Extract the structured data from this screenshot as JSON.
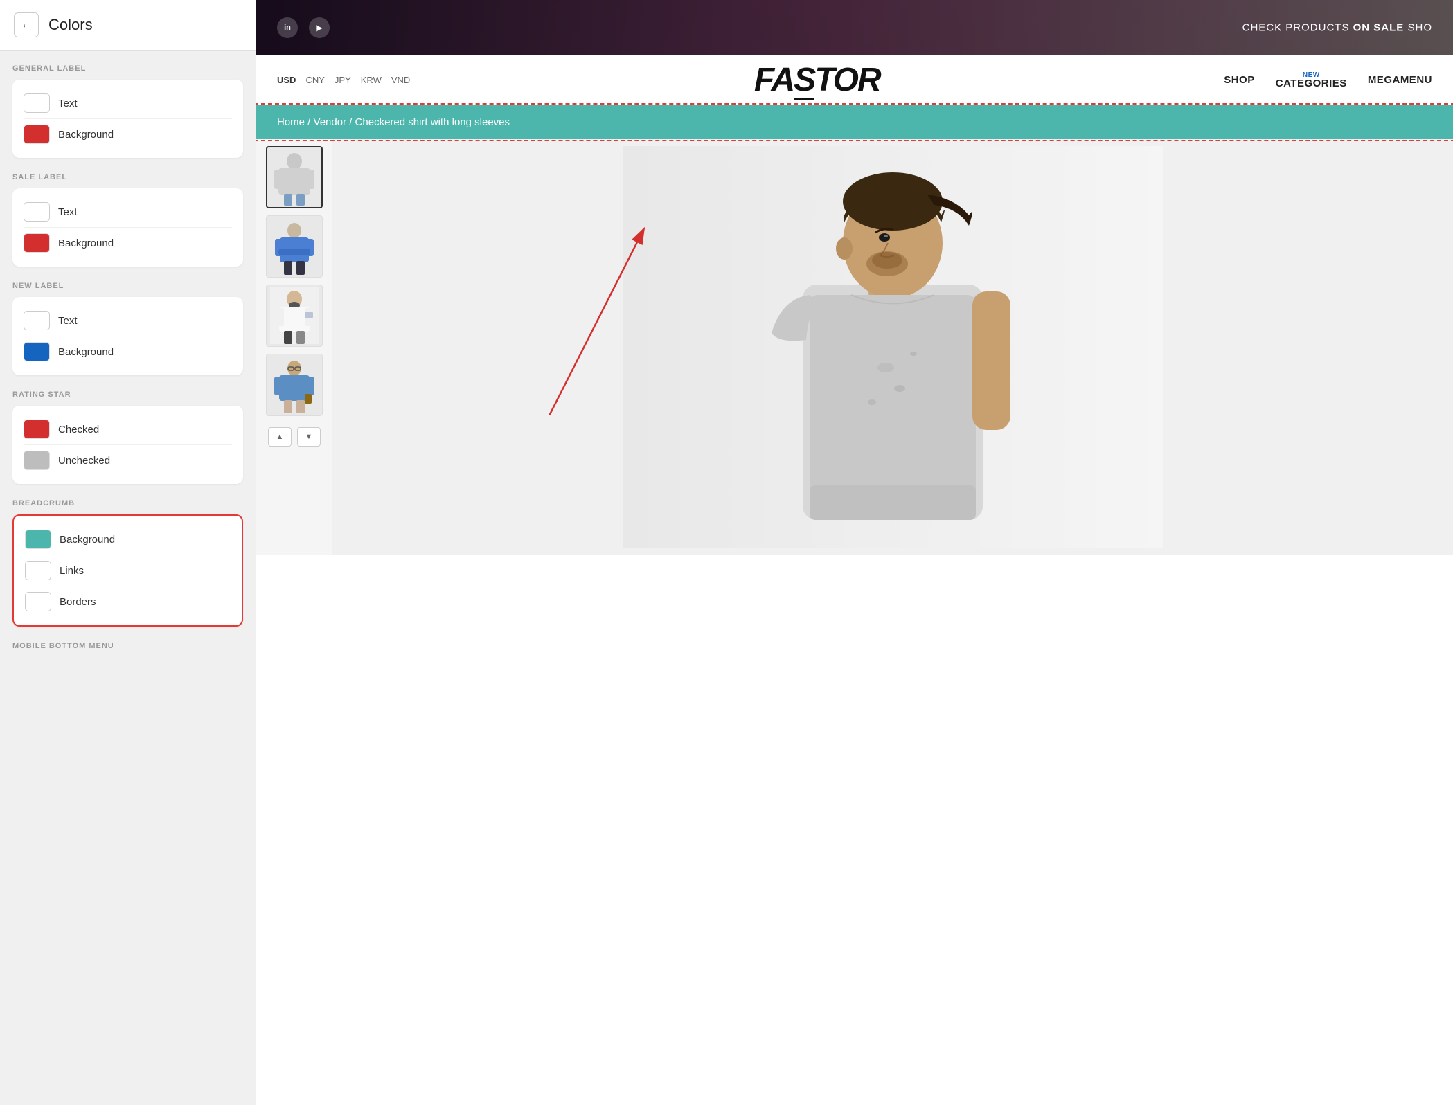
{
  "panel": {
    "title": "Colors",
    "back_label": "←",
    "sections": {
      "general_label": {
        "title": "GENERAL LABEL",
        "text_label": "Text",
        "background_label": "Background",
        "text_color": "#ffffff",
        "bg_color": "#d32f2f"
      },
      "sale_label": {
        "title": "SALE LABEL",
        "text_label": "Text",
        "background_label": "Background",
        "text_color": "#ffffff",
        "bg_color": "#d32f2f"
      },
      "new_label": {
        "title": "NEW LABEL",
        "text_label": "Text",
        "background_label": "Background",
        "text_color": "#ffffff",
        "bg_color": "#1565c0"
      },
      "rating_star": {
        "title": "RATING STAR",
        "checked_label": "Checked",
        "unchecked_label": "Unchecked",
        "checked_color": "#d32f2f",
        "unchecked_color": "#bdbdbd"
      },
      "breadcrumb": {
        "title": "BREADCRUMB",
        "background_label": "Background",
        "links_label": "Links",
        "borders_label": "Borders",
        "bg_color": "#4db6ac",
        "links_color": "#ffffff",
        "borders_color": "#ffffff"
      },
      "mobile_bottom_menu": {
        "title": "MOBILE BOTTOM MENU"
      }
    }
  },
  "store": {
    "currencies": [
      "USD",
      "CNY",
      "JPY",
      "KRW",
      "VND"
    ],
    "active_currency": "USD",
    "logo": "FASTOR",
    "nav_items": [
      "SHOP",
      "CATEGORIES",
      "MEGAMENU"
    ],
    "categories_badge": "NEW",
    "sale_text": "CHECK PRODUCTS ON SALE",
    "breadcrumb_path": "Home  /  Vendor  /  Checkered shirt with long sleeves"
  }
}
